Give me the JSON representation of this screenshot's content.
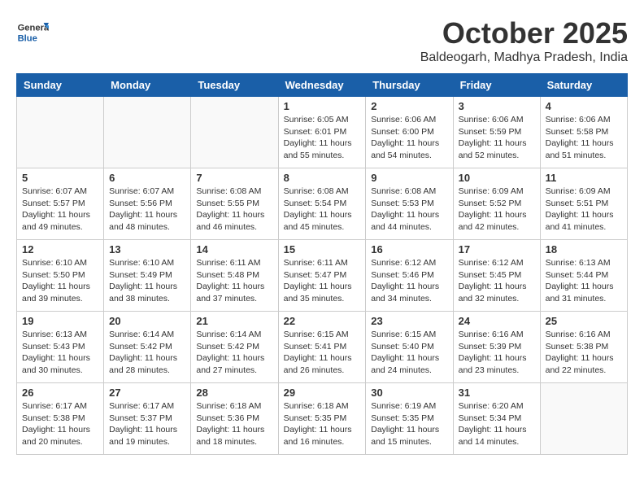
{
  "header": {
    "logo": {
      "general": "General",
      "blue": "Blue"
    },
    "title": "October 2025",
    "location": "Baldeogarh, Madhya Pradesh, India"
  },
  "weekdays": [
    "Sunday",
    "Monday",
    "Tuesday",
    "Wednesday",
    "Thursday",
    "Friday",
    "Saturday"
  ],
  "weeks": [
    [
      {
        "day": "",
        "content": ""
      },
      {
        "day": "",
        "content": ""
      },
      {
        "day": "",
        "content": ""
      },
      {
        "day": "1",
        "content": "Sunrise: 6:05 AM\nSunset: 6:01 PM\nDaylight: 11 hours\nand 55 minutes."
      },
      {
        "day": "2",
        "content": "Sunrise: 6:06 AM\nSunset: 6:00 PM\nDaylight: 11 hours\nand 54 minutes."
      },
      {
        "day": "3",
        "content": "Sunrise: 6:06 AM\nSunset: 5:59 PM\nDaylight: 11 hours\nand 52 minutes."
      },
      {
        "day": "4",
        "content": "Sunrise: 6:06 AM\nSunset: 5:58 PM\nDaylight: 11 hours\nand 51 minutes."
      }
    ],
    [
      {
        "day": "5",
        "content": "Sunrise: 6:07 AM\nSunset: 5:57 PM\nDaylight: 11 hours\nand 49 minutes."
      },
      {
        "day": "6",
        "content": "Sunrise: 6:07 AM\nSunset: 5:56 PM\nDaylight: 11 hours\nand 48 minutes."
      },
      {
        "day": "7",
        "content": "Sunrise: 6:08 AM\nSunset: 5:55 PM\nDaylight: 11 hours\nand 46 minutes."
      },
      {
        "day": "8",
        "content": "Sunrise: 6:08 AM\nSunset: 5:54 PM\nDaylight: 11 hours\nand 45 minutes."
      },
      {
        "day": "9",
        "content": "Sunrise: 6:08 AM\nSunset: 5:53 PM\nDaylight: 11 hours\nand 44 minutes."
      },
      {
        "day": "10",
        "content": "Sunrise: 6:09 AM\nSunset: 5:52 PM\nDaylight: 11 hours\nand 42 minutes."
      },
      {
        "day": "11",
        "content": "Sunrise: 6:09 AM\nSunset: 5:51 PM\nDaylight: 11 hours\nand 41 minutes."
      }
    ],
    [
      {
        "day": "12",
        "content": "Sunrise: 6:10 AM\nSunset: 5:50 PM\nDaylight: 11 hours\nand 39 minutes."
      },
      {
        "day": "13",
        "content": "Sunrise: 6:10 AM\nSunset: 5:49 PM\nDaylight: 11 hours\nand 38 minutes."
      },
      {
        "day": "14",
        "content": "Sunrise: 6:11 AM\nSunset: 5:48 PM\nDaylight: 11 hours\nand 37 minutes."
      },
      {
        "day": "15",
        "content": "Sunrise: 6:11 AM\nSunset: 5:47 PM\nDaylight: 11 hours\nand 35 minutes."
      },
      {
        "day": "16",
        "content": "Sunrise: 6:12 AM\nSunset: 5:46 PM\nDaylight: 11 hours\nand 34 minutes."
      },
      {
        "day": "17",
        "content": "Sunrise: 6:12 AM\nSunset: 5:45 PM\nDaylight: 11 hours\nand 32 minutes."
      },
      {
        "day": "18",
        "content": "Sunrise: 6:13 AM\nSunset: 5:44 PM\nDaylight: 11 hours\nand 31 minutes."
      }
    ],
    [
      {
        "day": "19",
        "content": "Sunrise: 6:13 AM\nSunset: 5:43 PM\nDaylight: 11 hours\nand 30 minutes."
      },
      {
        "day": "20",
        "content": "Sunrise: 6:14 AM\nSunset: 5:42 PM\nDaylight: 11 hours\nand 28 minutes."
      },
      {
        "day": "21",
        "content": "Sunrise: 6:14 AM\nSunset: 5:42 PM\nDaylight: 11 hours\nand 27 minutes."
      },
      {
        "day": "22",
        "content": "Sunrise: 6:15 AM\nSunset: 5:41 PM\nDaylight: 11 hours\nand 26 minutes."
      },
      {
        "day": "23",
        "content": "Sunrise: 6:15 AM\nSunset: 5:40 PM\nDaylight: 11 hours\nand 24 minutes."
      },
      {
        "day": "24",
        "content": "Sunrise: 6:16 AM\nSunset: 5:39 PM\nDaylight: 11 hours\nand 23 minutes."
      },
      {
        "day": "25",
        "content": "Sunrise: 6:16 AM\nSunset: 5:38 PM\nDaylight: 11 hours\nand 22 minutes."
      }
    ],
    [
      {
        "day": "26",
        "content": "Sunrise: 6:17 AM\nSunset: 5:38 PM\nDaylight: 11 hours\nand 20 minutes."
      },
      {
        "day": "27",
        "content": "Sunrise: 6:17 AM\nSunset: 5:37 PM\nDaylight: 11 hours\nand 19 minutes."
      },
      {
        "day": "28",
        "content": "Sunrise: 6:18 AM\nSunset: 5:36 PM\nDaylight: 11 hours\nand 18 minutes."
      },
      {
        "day": "29",
        "content": "Sunrise: 6:18 AM\nSunset: 5:35 PM\nDaylight: 11 hours\nand 16 minutes."
      },
      {
        "day": "30",
        "content": "Sunrise: 6:19 AM\nSunset: 5:35 PM\nDaylight: 11 hours\nand 15 minutes."
      },
      {
        "day": "31",
        "content": "Sunrise: 6:20 AM\nSunset: 5:34 PM\nDaylight: 11 hours\nand 14 minutes."
      },
      {
        "day": "",
        "content": ""
      }
    ]
  ]
}
